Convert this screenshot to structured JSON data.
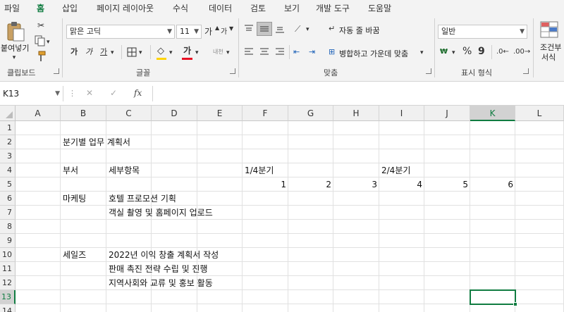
{
  "ribbon_tabs": [
    "파일",
    "홈",
    "삽입",
    "페이지 레이아웃",
    "수식",
    "데이터",
    "검토",
    "보기",
    "개발 도구",
    "도움말"
  ],
  "active_tab_index": 1,
  "clipboard": {
    "paste_label": "붙여넣기",
    "group_label": "클립보드"
  },
  "font": {
    "font_name": "맑은 고딕",
    "font_size": "11",
    "grow": "가",
    "shrink": "가",
    "bold": "가",
    "italic": "가",
    "underline": "가",
    "font_color_glyph": "가",
    "phonetic": "내천",
    "group_label": "글꼴"
  },
  "alignment": {
    "wrap_text": "자동 줄 바꿈",
    "merge_center": "병합하고 가운데 맞춤",
    "group_label": "맞춤"
  },
  "number": {
    "format": "일반",
    "percent": "%",
    "comma": "9",
    "group_label": "표시 형식"
  },
  "styles": {
    "conditional_line1": "조건부",
    "conditional_line2": "서식"
  },
  "formula_bar": {
    "name_box": "K13",
    "fx": "fx",
    "cancel": "✕",
    "enter": "✓",
    "formula": ""
  },
  "colors": {
    "accent": "#107c41",
    "font_color": "#e81123",
    "fill_color": "#ffd400"
  },
  "grid": {
    "columns": [
      "A",
      "B",
      "C",
      "D",
      "E",
      "F",
      "G",
      "H",
      "I",
      "J",
      "K",
      "L"
    ],
    "rows": [
      "1",
      "2",
      "3",
      "4",
      "5",
      "6",
      "7",
      "8",
      "9",
      "10",
      "11",
      "12",
      "13",
      "14"
    ],
    "selected_cell": "K13",
    "cells": {
      "B2": "분기별 업무 계획서",
      "B4": "부서",
      "C4": "세부항목",
      "F4": "1/4분기",
      "I4": "2/4분기",
      "F5": "1",
      "G5": "2",
      "H5": "3",
      "I5": "4",
      "J5": "5",
      "K5": "6",
      "B6": "마케팅",
      "C6": "호텔 프로모션 기획",
      "C7": "객실 촬영 및 홈페이지 업로드",
      "B10": "세일즈",
      "C10": "2022년 이익 창출 계획서 작성",
      "C11": "판매 촉진 전략 수립 및 진행",
      "C12": "지역사회와 교류 및 홍보 활동"
    }
  }
}
